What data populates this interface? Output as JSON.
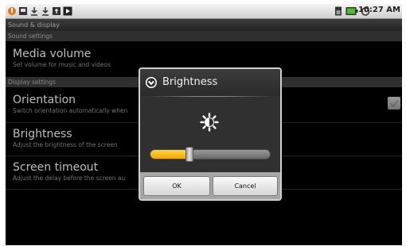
{
  "status_bar": {
    "time": "10:27 AM",
    "icons": [
      "usb-debug-icon",
      "sd-card-icon",
      "download-icon",
      "download-icon",
      "usb-icon",
      "media-play-icon",
      "sim-icon",
      "battery-icon",
      "alarm-clock-icon"
    ]
  },
  "screen": {
    "title": "Sound & display"
  },
  "sections": {
    "sound": "Sound settings",
    "display": "Display settings"
  },
  "prefs": {
    "media_volume": {
      "title": "Media volume",
      "summary": "Set volume for music and videos"
    },
    "orientation": {
      "title": "Orientation",
      "summary": "Switch orientation automatically when",
      "checked": true
    },
    "brightness": {
      "title": "Brightness",
      "summary": "Adjust the brightness of the screen"
    },
    "screen_timeout": {
      "title": "Screen timeout",
      "summary": "Adjust the delay before the screen au"
    }
  },
  "dialog": {
    "title": "Brightness",
    "icon": "brightness-sun-icon",
    "slider_level": 0.33,
    "ok_label": "OK",
    "cancel_label": "Cancel"
  },
  "colors": {
    "slider_fill": "#f2b400",
    "background": "#000000"
  }
}
